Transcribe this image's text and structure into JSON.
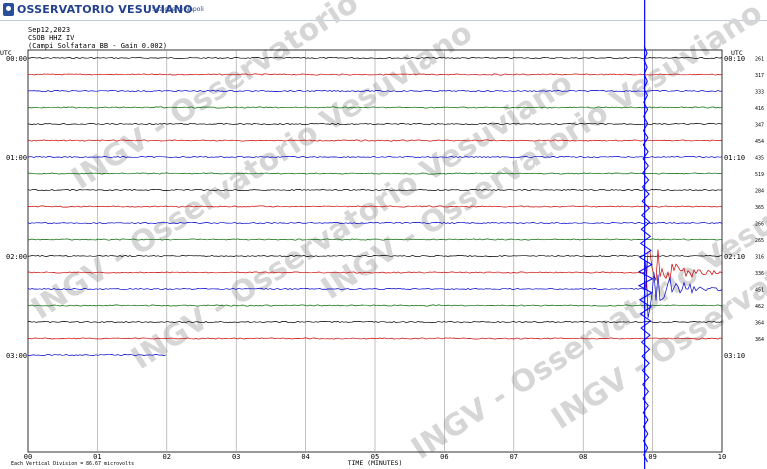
{
  "header": {
    "title": "OSSERVATORIO VESUVIANO",
    "subtitle": "Sezione di Napoli",
    "brand_color": "#23418c"
  },
  "info": {
    "date": "Sep12,2023",
    "station": "CSOB HHZ IV",
    "station_name": "(Campi Solfatara BB - Gain 0.002)"
  },
  "watermark": {
    "text": "INGV - Osservatorio Vesuviano",
    "color": "#d6d6d6"
  },
  "footer": {
    "legend_left": "Each Vertical Division =",
    "legend_value": "86.67 microvolts"
  },
  "chart_data": {
    "type": "line",
    "title": "",
    "xlabel": "TIME (MINUTES)",
    "x_ticks": [
      "00",
      "01",
      "02",
      "03",
      "04",
      "05",
      "06",
      "07",
      "08",
      "09",
      "10"
    ],
    "xlim": [
      0,
      10
    ],
    "y_axis_label_left": "UTC",
    "y_axis_label_right": "UTC",
    "left_time_labels": [
      {
        "row": 0,
        "label": "00:00"
      },
      {
        "row": 6,
        "label": "01:00"
      },
      {
        "row": 12,
        "label": "02:00"
      },
      {
        "row": 18,
        "label": "03:00"
      }
    ],
    "right_time_labels": [
      {
        "row": 0,
        "label": "00:10"
      },
      {
        "row": 6,
        "label": "01:10"
      },
      {
        "row": 12,
        "label": "02:10"
      },
      {
        "row": 18,
        "label": "03:10"
      }
    ],
    "trace_colors": [
      "#000000",
      "#cc0000",
      "#0000cc",
      "#006600"
    ],
    "rows_total": 19,
    "partial_last_row_minutes": 2,
    "right_values": [
      "261",
      "317",
      "333",
      "416",
      "347",
      "454",
      "435",
      "519",
      "284",
      "365",
      "266",
      "265",
      "316",
      "336",
      "451",
      "462",
      "364",
      "364"
    ],
    "event": {
      "minute": 8.9,
      "row_start": 0,
      "row_end": 23,
      "peak_row": 13.5,
      "color": "#0000ff"
    },
    "grid": true
  }
}
